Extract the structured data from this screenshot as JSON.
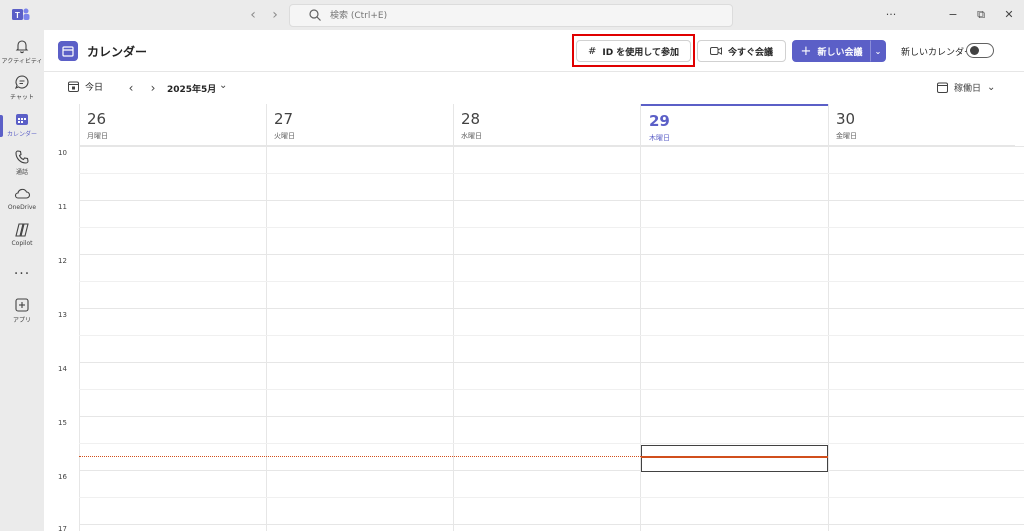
{
  "search": {
    "placeholder": "検索 (Ctrl+E)"
  },
  "titlebar": {
    "more": "···",
    "minimize": "−",
    "restore": "⧉",
    "close": "✕"
  },
  "rail": {
    "items": [
      {
        "label": "アクティビティ"
      },
      {
        "label": "チャット"
      },
      {
        "label": "カレンダー"
      },
      {
        "label": "通話"
      },
      {
        "label": "OneDrive"
      },
      {
        "label": "Copilot"
      },
      {
        "label": "アプリ"
      }
    ],
    "more": "···"
  },
  "header": {
    "title": "カレンダー",
    "join_label": "ID を使用して参加",
    "meet_now_label": "今すぐ会議",
    "new_meeting_label": "新しい会議",
    "new_calendar_label": "新しいカレンダー"
  },
  "toolbar": {
    "today_label": "今日",
    "month": "2025年5月",
    "view": "稼働日"
  },
  "days": [
    {
      "num": "26",
      "dow": "月曜日"
    },
    {
      "num": "27",
      "dow": "火曜日"
    },
    {
      "num": "28",
      "dow": "水曜日"
    },
    {
      "num": "29",
      "dow": "木曜日",
      "today": true
    },
    {
      "num": "30",
      "dow": "金曜日"
    }
  ],
  "hours": [
    "10",
    "11",
    "12",
    "13",
    "14",
    "15",
    "16",
    "17"
  ],
  "colors": {
    "accent": "#5b5fc7",
    "now": "#d14f1c",
    "highlight": "#e00000"
  }
}
